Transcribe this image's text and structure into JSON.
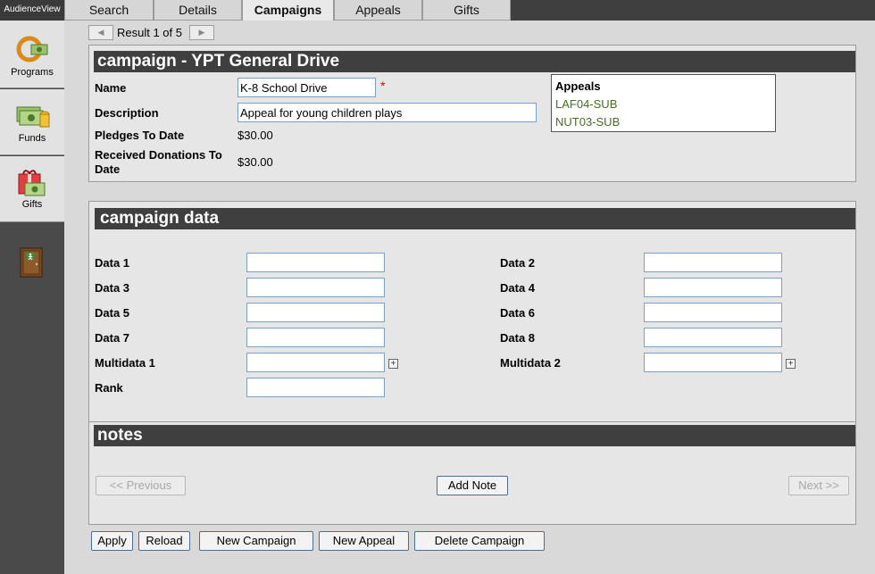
{
  "app": {
    "title": "AudienceView"
  },
  "tabs": [
    {
      "label": "Search"
    },
    {
      "label": "Details"
    },
    {
      "label": "Campaigns",
      "active": true
    },
    {
      "label": "Appeals"
    },
    {
      "label": "Gifts"
    }
  ],
  "sidebar": {
    "items": [
      {
        "label": "Programs",
        "icon": "programs-icon"
      },
      {
        "label": "Funds",
        "icon": "funds-icon"
      },
      {
        "label": "Gifts",
        "icon": "gifts-icon"
      },
      {
        "label": "",
        "icon": "exit-door-icon"
      }
    ]
  },
  "pager": {
    "text": "Result 1 of 5"
  },
  "campaign": {
    "title": "campaign - YPT General Drive",
    "name_label": "Name",
    "name_value": "K-8 School Drive",
    "required_mark": "*",
    "description_label": "Description",
    "description_value": "Appeal for young children plays",
    "pledges_label": "Pledges To Date",
    "pledges_value": "$30.00",
    "received_label_1": "Received Donations To",
    "received_label_2": "Date",
    "received_value": "$30.00",
    "appeals_heading": "Appeals",
    "appeals": [
      "LAF04-SUB",
      "NUT03-SUB"
    ]
  },
  "campaign_data": {
    "title": "campaign data",
    "fields": [
      {
        "label": "Data 1",
        "value": ""
      },
      {
        "label": "Data 2",
        "value": ""
      },
      {
        "label": "Data 3",
        "value": ""
      },
      {
        "label": "Data 4",
        "value": ""
      },
      {
        "label": "Data 5",
        "value": ""
      },
      {
        "label": "Data 6",
        "value": ""
      },
      {
        "label": "Data 7",
        "value": ""
      },
      {
        "label": "Data 8",
        "value": ""
      },
      {
        "label": "Multidata 1",
        "value": ""
      },
      {
        "label": "Multidata 2",
        "value": ""
      },
      {
        "label": "Rank",
        "value": ""
      }
    ]
  },
  "notes": {
    "title": "notes",
    "previous_label": "<< Previous",
    "add_note_label": "Add Note",
    "next_label": "Next >>"
  },
  "actions": {
    "apply": "Apply",
    "reload": "Reload",
    "new_campaign": "New Campaign",
    "new_appeal": "New Appeal",
    "delete_campaign": "Delete Campaign"
  },
  "colors": {
    "header_bg": "#3f3f3f",
    "appeal_link": "#4a6b22",
    "required": "#dd0000",
    "input_border": "#7aa0c4"
  }
}
